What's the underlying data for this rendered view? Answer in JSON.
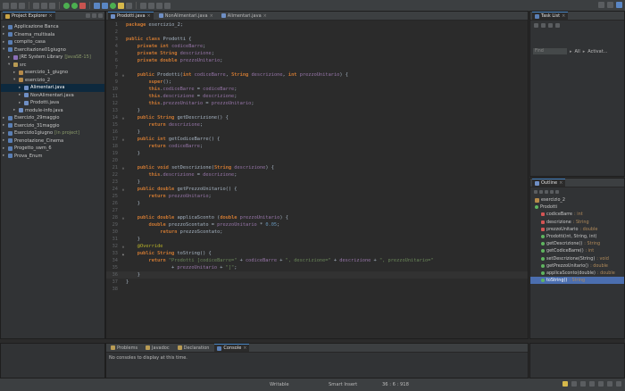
{
  "explorer": {
    "title": "Project Explorer",
    "items": [
      {
        "label": "Applicazione Banca",
        "level": 0,
        "arrow": "▸",
        "icon": "project"
      },
      {
        "label": "Cinema_multisala",
        "level": 0,
        "arrow": "▸",
        "icon": "project"
      },
      {
        "label": "compito_casa",
        "level": 0,
        "arrow": "▸",
        "icon": "project"
      },
      {
        "label": "Esercitazione01giugno",
        "level": 0,
        "arrow": "▾",
        "icon": "project"
      },
      {
        "label": "JRE System Library",
        "extra": "[JavaSE-15]",
        "level": 1,
        "arrow": "▸",
        "icon": "lib"
      },
      {
        "label": "src",
        "level": 1,
        "arrow": "▾",
        "icon": "src"
      },
      {
        "label": "esercizio_1_giugno",
        "level": 2,
        "arrow": "▸",
        "icon": "pkg"
      },
      {
        "label": "esercizio_2",
        "level": 2,
        "arrow": "▾",
        "icon": "pkg"
      },
      {
        "label": "Alimentari.java",
        "level": 3,
        "arrow": "▸",
        "icon": "java",
        "selected": true
      },
      {
        "label": "NonAlimentari.java",
        "level": 3,
        "arrow": "▸",
        "icon": "java"
      },
      {
        "label": "Prodotti.java",
        "level": 3,
        "arrow": "▸",
        "icon": "java"
      },
      {
        "label": "module-info.java",
        "level": 2,
        "arrow": "▸",
        "icon": "java"
      },
      {
        "label": "Esercizio_29maggio",
        "level": 0,
        "arrow": "▸",
        "icon": "project"
      },
      {
        "label": "Esercizio_31maggio",
        "level": 0,
        "arrow": "▸",
        "icon": "project"
      },
      {
        "label": "Esercizio1giugno",
        "extra": "[in project]",
        "level": 0,
        "arrow": "▸",
        "icon": "project"
      },
      {
        "label": "Prenotazione_Cinema",
        "level": 0,
        "arrow": "▸",
        "icon": "project"
      },
      {
        "label": "Progetto_swm_6",
        "level": 0,
        "arrow": "▸",
        "icon": "project"
      },
      {
        "label": "Prova_Enum",
        "level": 0,
        "arrow": "▸",
        "icon": "project"
      }
    ]
  },
  "editor": {
    "tabs": [
      {
        "label": "Prodotti.java",
        "active": true
      },
      {
        "label": "NonAlimentari.java",
        "active": false
      },
      {
        "label": "Alimentari.java",
        "active": false
      }
    ],
    "lines": [
      {
        "n": "1",
        "g": "",
        "t": "package esercizio_2;"
      },
      {
        "n": "2",
        "g": "",
        "t": ""
      },
      {
        "n": "3",
        "g": "",
        "t": "public class Prodotti {"
      },
      {
        "n": "4",
        "g": "",
        "t": "    private int codiceBarre;"
      },
      {
        "n": "5",
        "g": "",
        "t": "    private String descrizione;"
      },
      {
        "n": "6",
        "g": "",
        "t": "    private double prezzoUnitario;"
      },
      {
        "n": "7",
        "g": "",
        "t": ""
      },
      {
        "n": "8",
        "g": "⊖",
        "t": "    public Prodotti(int codiceBarre, String descrizione, int prezzoUnitario) {"
      },
      {
        "n": "9",
        "g": "",
        "t": "        super();"
      },
      {
        "n": "10",
        "g": "",
        "t": "        this.codiceBarre = codiceBarre;"
      },
      {
        "n": "11",
        "g": "",
        "t": "        this.descrizione = descrizione;"
      },
      {
        "n": "12",
        "g": "",
        "t": "        this.prezzoUnitario = prezzoUnitario;"
      },
      {
        "n": "13",
        "g": "",
        "t": "    }"
      },
      {
        "n": "14",
        "g": "⊖",
        "t": "    public String getDescrizione() {"
      },
      {
        "n": "15",
        "g": "",
        "t": "        return descrizione;"
      },
      {
        "n": "16",
        "g": "",
        "t": "    }"
      },
      {
        "n": "17",
        "g": "⊖",
        "t": "    public int getCodiceBarre() {"
      },
      {
        "n": "18",
        "g": "",
        "t": "        return codiceBarre;"
      },
      {
        "n": "19",
        "g": "",
        "t": "    }"
      },
      {
        "n": "20",
        "g": "",
        "t": ""
      },
      {
        "n": "21",
        "g": "⊖",
        "t": "    public void setDescrizione(String descrizione) {"
      },
      {
        "n": "22",
        "g": "",
        "t": "        this.descrizione = descrizione;"
      },
      {
        "n": "23",
        "g": "",
        "t": "    }"
      },
      {
        "n": "24",
        "g": "⊖",
        "t": "    public double getPrezzoUnitario() {"
      },
      {
        "n": "25",
        "g": "",
        "t": "        return prezzoUnitario;"
      },
      {
        "n": "26",
        "g": "",
        "t": "    }"
      },
      {
        "n": "27",
        "g": "",
        "t": ""
      },
      {
        "n": "28",
        "g": "⊖",
        "t": "    public double applicaSconto (double prezzoUnitario) {"
      },
      {
        "n": "29",
        "g": "",
        "t": "        double prezzoScontato = prezzoUnitario * 0.05;"
      },
      {
        "n": "30",
        "g": "",
        "t": "            return prezzoScontato;"
      },
      {
        "n": "31",
        "g": "",
        "t": "    }"
      },
      {
        "n": "32",
        "g": "⊖",
        "t": "    @Override"
      },
      {
        "n": "33",
        "g": "▲",
        "t": "    public String toString() {"
      },
      {
        "n": "34",
        "g": "",
        "t": "        return \"Prodotti [codiceBarre=\" + codiceBarre + \", descrizione=\" + descrizione + \", prezzoUnitario=\""
      },
      {
        "n": "35",
        "g": "",
        "t": "                + prezzoUnitario + \"]\";"
      },
      {
        "n": "36",
        "g": "",
        "t": "    }"
      },
      {
        "n": "37",
        "g": "",
        "t": "}"
      },
      {
        "n": "38",
        "g": "",
        "t": ""
      }
    ]
  },
  "tasklist": {
    "title": "Task List",
    "find_placeholder": "Find",
    "all_label": "All",
    "activate_label": "Activat..."
  },
  "outline": {
    "title": "Outline",
    "items": [
      {
        "label": "esercizio_2",
        "type": "",
        "level": 0,
        "icon": "pkg"
      },
      {
        "label": "Prodotti",
        "type": "",
        "level": 0,
        "icon": "class"
      },
      {
        "label": "codiceBarre",
        "type": ": int",
        "level": 1,
        "icon": "field"
      },
      {
        "label": "descrizione",
        "type": ": String",
        "level": 1,
        "icon": "field"
      },
      {
        "label": "prezzoUnitario",
        "type": ": double",
        "level": 1,
        "icon": "field"
      },
      {
        "label": "Prodotti(int, String, int)",
        "type": "",
        "level": 1,
        "icon": "ctor"
      },
      {
        "label": "getDescrizione()",
        "type": ": String",
        "level": 1,
        "icon": "method"
      },
      {
        "label": "getCodiceBarre()",
        "type": ": int",
        "level": 1,
        "icon": "method"
      },
      {
        "label": "setDescrizione(String)",
        "type": ": void",
        "level": 1,
        "icon": "method"
      },
      {
        "label": "getPrezzoUnitario()",
        "type": ": double",
        "level": 1,
        "icon": "method"
      },
      {
        "label": "applicaSconto(double)",
        "type": ": double",
        "level": 1,
        "icon": "method"
      },
      {
        "label": "toString()",
        "type": ": String",
        "level": 1,
        "icon": "method",
        "selected": true
      }
    ]
  },
  "console": {
    "tabs": [
      {
        "label": "Problems",
        "active": false
      },
      {
        "label": "Javadoc",
        "active": false
      },
      {
        "label": "Declaration",
        "active": false
      },
      {
        "label": "Console",
        "active": true
      }
    ],
    "message": "No consoles to display at this time."
  },
  "status": {
    "writable": "Writable",
    "insert_mode": "Smart Insert",
    "position": "36 : 6 : 918"
  },
  "colors": {
    "keyword": "#cc7832",
    "field": "#9876aa",
    "string": "#6a8759",
    "number": "#6897bb",
    "annotation": "#bbb529",
    "plain": "#a9b7c6",
    "selection": "#4b6eaf"
  }
}
